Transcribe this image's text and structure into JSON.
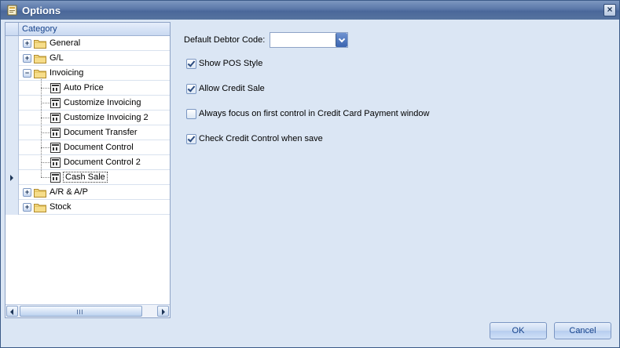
{
  "window": {
    "title": "Options",
    "close_glyph": "×"
  },
  "tree": {
    "header": "Category",
    "items": [
      {
        "label": "General",
        "level": 0,
        "kind": "folder",
        "expander": "+"
      },
      {
        "label": "G/L",
        "level": 0,
        "kind": "folder",
        "expander": "+"
      },
      {
        "label": "Invoicing",
        "level": 0,
        "kind": "folder",
        "expander": "−"
      },
      {
        "label": "Auto Price",
        "level": 1,
        "kind": "doc"
      },
      {
        "label": "Customize Invoicing",
        "level": 1,
        "kind": "doc"
      },
      {
        "label": "Customize Invoicing 2",
        "level": 1,
        "kind": "doc"
      },
      {
        "label": "Document Transfer",
        "level": 1,
        "kind": "doc"
      },
      {
        "label": "Document Control",
        "level": 1,
        "kind": "doc"
      },
      {
        "label": "Document Control 2",
        "level": 1,
        "kind": "doc"
      },
      {
        "label": "Cash Sale",
        "level": 1,
        "kind": "doc",
        "selected": true
      },
      {
        "label": "A/R & A/P",
        "level": 0,
        "kind": "folder",
        "expander": "+"
      },
      {
        "label": "Stock",
        "level": 0,
        "kind": "folder",
        "expander": "+"
      }
    ]
  },
  "settings": {
    "debtor_label": "Default Debtor Code:",
    "debtor_value": "",
    "options": [
      {
        "label": "Show POS Style",
        "checked": true
      },
      {
        "label": "Allow Credit Sale",
        "checked": true
      },
      {
        "label": "Always focus on first control in Credit Card Payment window",
        "checked": false
      },
      {
        "label": "Check Credit Control when save",
        "checked": true
      }
    ]
  },
  "buttons": {
    "ok": "OK",
    "cancel": "Cancel"
  },
  "colors": {
    "accent": "#15428b",
    "titlebar": "#5a77a8",
    "background": "#dbe6f4"
  }
}
